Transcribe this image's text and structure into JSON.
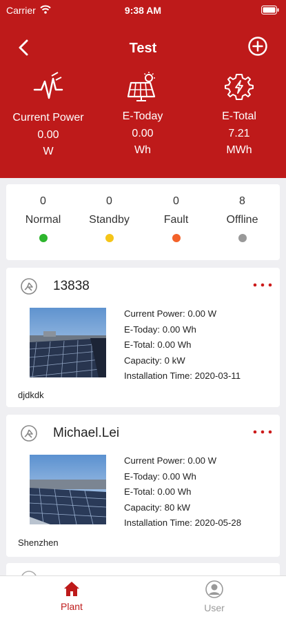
{
  "status_bar": {
    "carrier": "Carrier",
    "time": "9:38 AM"
  },
  "nav": {
    "title": "Test"
  },
  "summary": [
    {
      "label": "Current Power",
      "value": "0.00",
      "unit": "W",
      "icon": "power-wave-icon"
    },
    {
      "label": "E-Today",
      "value": "0.00",
      "unit": "Wh",
      "icon": "solar-panel-sun-icon"
    },
    {
      "label": "E-Total",
      "value": "7.21",
      "unit": "MWh",
      "icon": "gear-bolt-icon"
    }
  ],
  "status_counts": [
    {
      "count": "0",
      "label": "Normal",
      "color": "#2db52d"
    },
    {
      "count": "0",
      "label": "Standby",
      "color": "#f5c518"
    },
    {
      "count": "0",
      "label": "Fault",
      "color": "#f3622a"
    },
    {
      "count": "8",
      "label": "Offline",
      "color": "#999999"
    }
  ],
  "plants": [
    {
      "name": "13838",
      "current_power": "Current Power: 0.00 W",
      "e_today": "E-Today: 0.00 Wh",
      "e_total": "E-Total: 0.00 Wh",
      "capacity": "Capacity: 0 kW",
      "installation_time": "Installation Time: 2020-03-11",
      "location": "djdkdk"
    },
    {
      "name": "Michael.Lei",
      "current_power": "Current Power: 0.00 W",
      "e_today": "E-Today: 0.00 Wh",
      "e_total": "E-Total: 0.00 Wh",
      "capacity": "Capacity: 80 kW",
      "installation_time": "Installation Time: 2020-05-28",
      "location": "Shenzhen"
    }
  ],
  "tabs": [
    {
      "label": "Plant",
      "active": true,
      "icon": "home-icon"
    },
    {
      "label": "User",
      "active": false,
      "icon": "user-icon"
    }
  ],
  "colors": {
    "header": "#be1a1a",
    "accent": "#be1a1a",
    "inactive_tab": "#999999"
  }
}
